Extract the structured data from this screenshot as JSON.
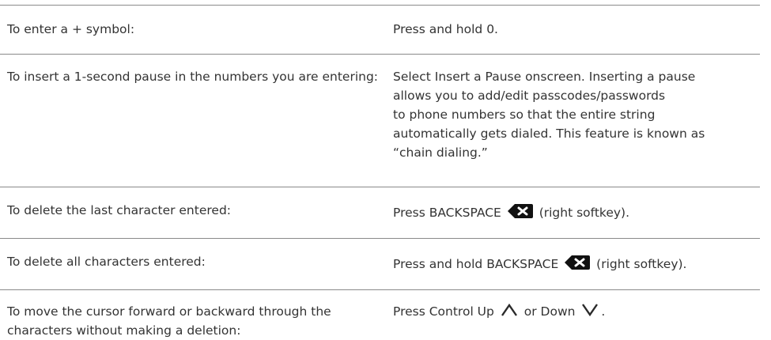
{
  "rows": [
    {
      "action": "To enter a + symbol:",
      "instruction": "Press and hold 0."
    },
    {
      "action": "To insert a 1-second pause in the numbers you are entering:",
      "instruction_lines": [
        "Select Insert a Pause onscreen. Inserting a pause",
        "allows you to add/edit passcodes/passwords",
        "to phone numbers so that the entire string",
        "automatically gets dialed. This feature is known as",
        "“chain dialing.”"
      ]
    },
    {
      "action": "To delete the last character entered:",
      "instruction_before": "Press BACKSPACE",
      "instruction_after": "(right softkey)."
    },
    {
      "action": "To delete all characters entered:",
      "instruction_before": "Press and hold BACKSPACE",
      "instruction_after": "(right softkey)."
    },
    {
      "action": "To move the cursor forward or backward through the characters without making a deletion:",
      "instruction_before": "Press Control Up",
      "instruction_middle": "or Down",
      "instruction_after": "."
    }
  ],
  "icons": {
    "backspace": "backspace-icon",
    "up": "chevron-up-icon",
    "down": "chevron-down-icon"
  }
}
